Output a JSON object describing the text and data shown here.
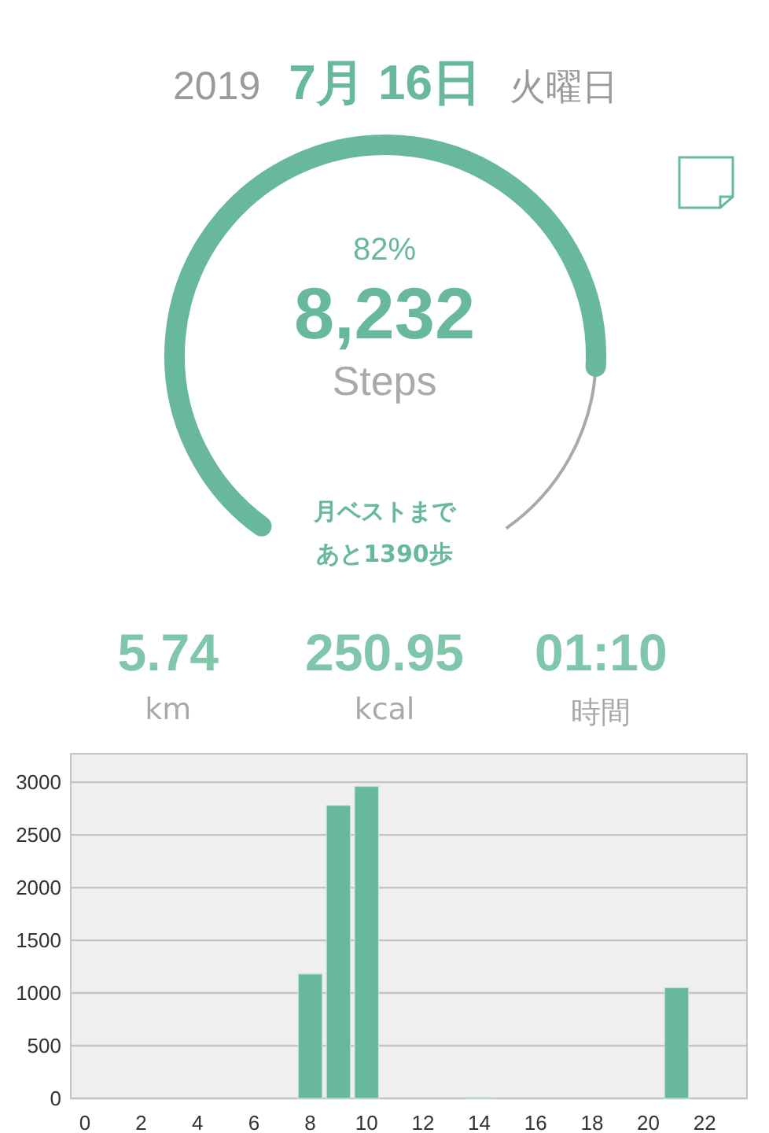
{
  "date": {
    "year": "2019",
    "month_day": "7月 16日",
    "weekday": "火曜日"
  },
  "gauge": {
    "percent": "82%",
    "steps": "8,232",
    "unit": "Steps",
    "best_note": [
      "月ベストまで",
      "あと1390歩"
    ]
  },
  "stats": [
    {
      "value": "5.74",
      "label": "km"
    },
    {
      "value": "250.95",
      "label": "kcal"
    },
    {
      "value": "01:10",
      "label": "時間"
    }
  ],
  "chart_data": {
    "type": "bar",
    "grid": true,
    "x": [
      0,
      1,
      2,
      3,
      4,
      5,
      6,
      7,
      8,
      9,
      10,
      11,
      12,
      13,
      14,
      15,
      16,
      17,
      18,
      19,
      20,
      21,
      22,
      23
    ],
    "series": [
      {
        "color": "#68b99b",
        "values": [
          0,
          0,
          0,
          0,
          0,
          0,
          0,
          0,
          1180,
          2780,
          2960,
          0,
          0,
          0,
          10,
          0,
          0,
          0,
          0,
          0,
          0,
          1050,
          0,
          0
        ]
      }
    ],
    "xlim": [
      -0.5,
      23.5
    ],
    "ylim": [
      0,
      3270
    ],
    "xticks": [
      0,
      2,
      4,
      6,
      8,
      10,
      12,
      14,
      16,
      18,
      20,
      22
    ],
    "yticks": [
      0,
      500,
      1000,
      1500,
      2000,
      2500,
      3000
    ]
  }
}
